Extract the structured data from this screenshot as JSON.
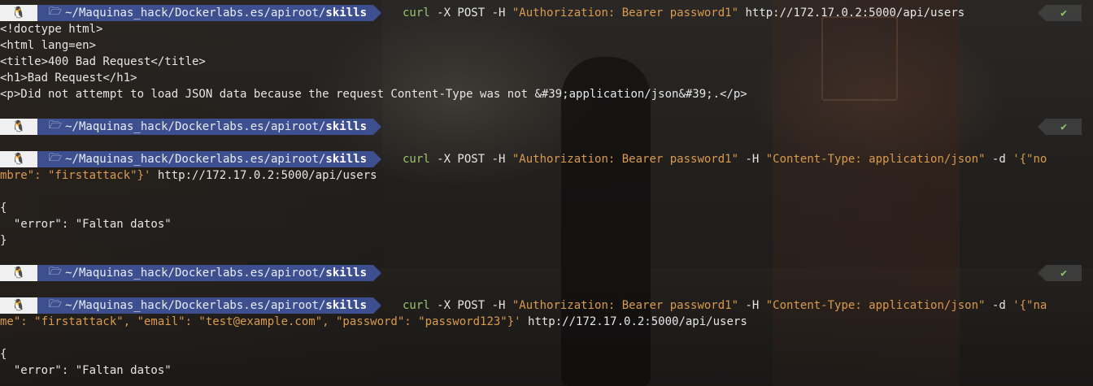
{
  "prompt": {
    "path_prefix": "~/Maquinas_hack/Dockerlabs.es/apiroot/",
    "path_current": "skills",
    "os_icon": "tux-icon",
    "folder_icon": "folder-icon",
    "status_ok": "✔"
  },
  "blocks": [
    {
      "cmd_name": "curl",
      "cmd_args1": " -X POST -H ",
      "cmd_str1": "\"Authorization: Bearer password1\"",
      "cmd_args2": " http://172.17.0.2:5000/api/users",
      "output": [
        "<!doctype html>",
        "<html lang=en>",
        "<title>400 Bad Request</title>",
        "<h1>Bad Request</h1>",
        "<p>Did not attempt to load JSON data because the request Content-Type was not &#39;application/json&#39;.</p>"
      ]
    },
    {
      "cmd_name": "curl",
      "cmd_args1": " -X POST -H ",
      "cmd_str1": "\"Authorization: Bearer password1\"",
      "cmd_mid": " -H ",
      "cmd_str2": "\"Content-Type: application/json\"",
      "cmd_mid2": " -d ",
      "cmd_str3a": "'{\"no",
      "wrap_str": "mbre\": \"firstattack\"}'",
      "wrap_rest": " http://172.17.0.2:5000/api/users",
      "output": [
        "{",
        "  \"error\": \"Faltan datos\"",
        "}"
      ]
    },
    {
      "cmd_name": "curl",
      "cmd_args1": " -X POST -H ",
      "cmd_str1": "\"Authorization: Bearer password1\"",
      "cmd_mid": " -H ",
      "cmd_str2": "\"Content-Type: application/json\"",
      "cmd_mid2": " -d ",
      "cmd_str3a": "'{\"na",
      "wrap_str": "me\": \"firstattack\", \"email\": \"test@example.com\", \"password\": \"password123\"}'",
      "wrap_rest": " http://172.17.0.2:5000/api/users",
      "output": [
        "{",
        "  \"error\": \"Faltan datos\""
      ]
    }
  ]
}
